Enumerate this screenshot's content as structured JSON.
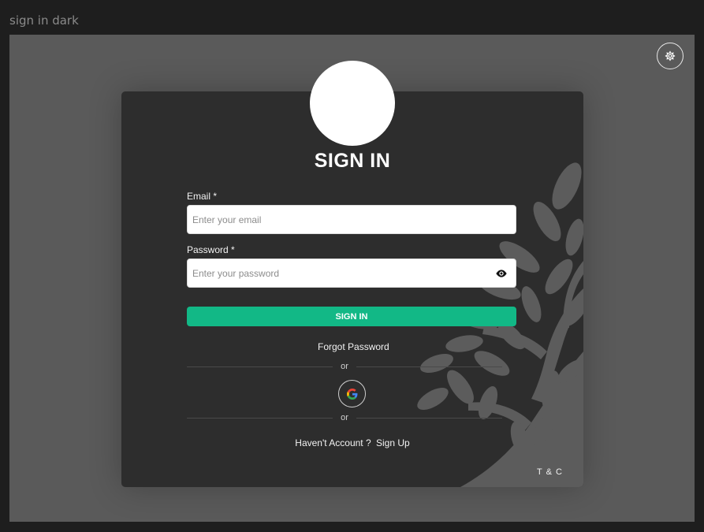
{
  "window": {
    "title": "sign in dark"
  },
  "header": {
    "settings_icon": "gear-icon"
  },
  "form": {
    "heading": "SIGN IN",
    "email_label": "Email *",
    "email_placeholder": "Enter your email",
    "email_value": "",
    "password_label": "Password *",
    "password_placeholder": "Enter your password",
    "password_value": "",
    "password_toggle_icon": "eye-icon",
    "submit_label": "SIGN IN",
    "forgot_password": "Forgot Password",
    "divider_text_1": "or",
    "divider_text_2": "or",
    "google_icon": "google-icon",
    "no_account_text": "Haven't Account ?",
    "signup_link": "Sign Up",
    "terms_link": "T & C"
  },
  "colors": {
    "page_bg": "#1e1e1e",
    "stage_bg": "#5a5a5a",
    "card_bg": "#2d2d2d",
    "accent": "#12b886",
    "tree": "#5c5c5c"
  }
}
